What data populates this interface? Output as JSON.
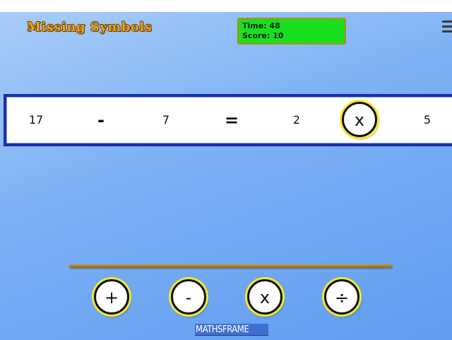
{
  "game": {
    "title": "Missing Symbols",
    "time_label": "Time: 48",
    "score_label": "Score: 10"
  },
  "equation": {
    "operand_a": "17",
    "operator_1": "-",
    "operand_b": "7",
    "equals": "=",
    "operand_c": "2",
    "placed_symbol": "x",
    "operand_d": "5"
  },
  "options": [
    {
      "symbol": "+"
    },
    {
      "symbol": "-"
    },
    {
      "symbol": "x"
    },
    {
      "symbol": "÷"
    }
  ],
  "footer": {
    "logo_text": "MATHSFRAME"
  },
  "icons": {
    "menu": "hamburger-menu-icon"
  },
  "colors": {
    "timer_box": "#19e01e",
    "title": "#f3a21a",
    "equation_border": "#1a2fa8",
    "token_ring": "#f4ea2a"
  }
}
